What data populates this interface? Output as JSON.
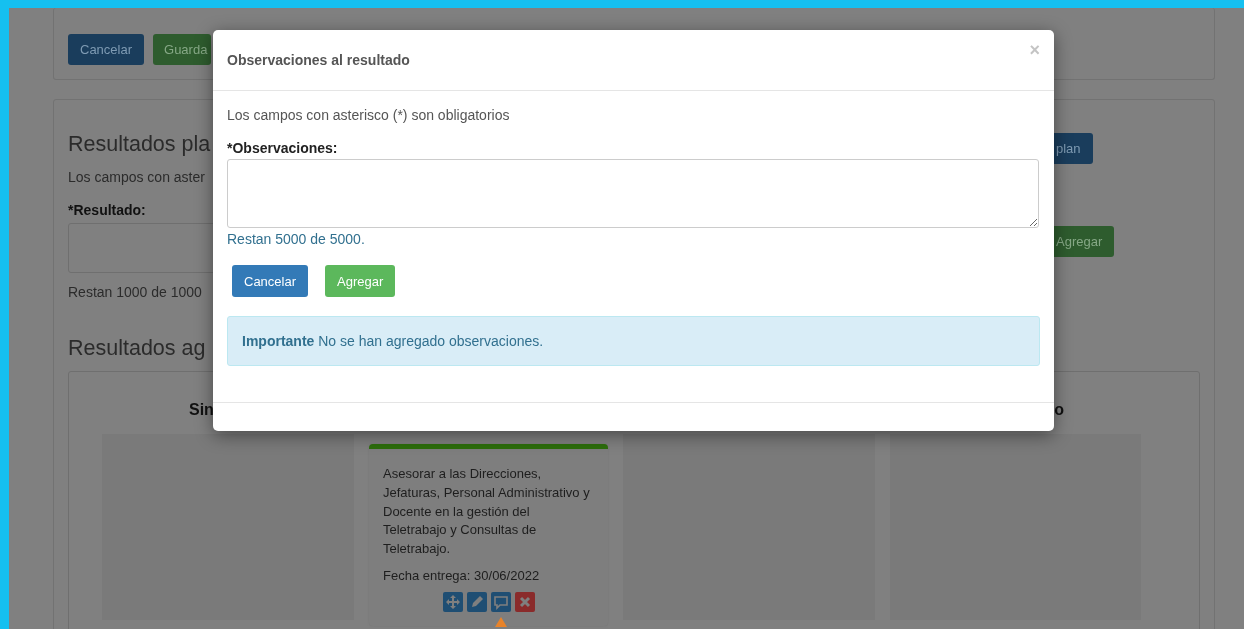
{
  "page": {
    "top_buttons": [
      {
        "label": "Cancelar",
        "kind": "primary"
      },
      {
        "label": "Guarda",
        "kind": "success"
      }
    ],
    "plan_section": {
      "title": "Resultados pla",
      "note": "Los campos con aster",
      "field_label": "*Resultado:",
      "counter": "Restan 1000 de 1000",
      "plan_button": "plan",
      "add_button": "Agregar"
    },
    "results_section": {
      "title": "Resultados ag",
      "columns": [
        {
          "header": "Sin"
        },
        {
          "cards": [
            {
              "text": "Asesorar a las Direcciones, Jefaturas, Personal Administrativo y Docente en la gestión del Teletrabajo y Consultas de Teletrabajo.",
              "date": "Fecha entrega: 30/06/2022",
              "actions": [
                {
                  "kind": "move"
                },
                {
                  "kind": "edit"
                },
                {
                  "kind": "comment"
                },
                {
                  "kind": "delete"
                }
              ]
            }
          ]
        },
        {},
        {
          "header": "o"
        }
      ]
    }
  },
  "modal": {
    "title": "Observaciones al resultado",
    "close": "×",
    "note": "Los campos con asterisco (*) son obligatorios",
    "field_label": "*Observaciones:",
    "counter": "Restan 5000 de 5000.",
    "buttons": [
      {
        "label": "Cancelar",
        "kind": "primary"
      },
      {
        "label": "Agregar",
        "kind": "success"
      }
    ],
    "alert": "**Importante** No se han agregado observaciones."
  }
}
